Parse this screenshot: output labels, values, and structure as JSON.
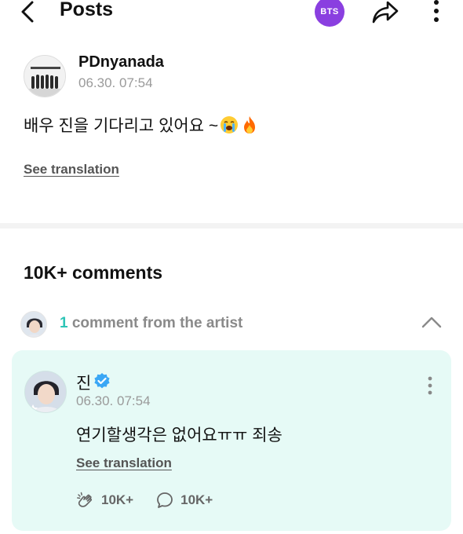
{
  "header": {
    "title": "Posts",
    "community_badge": "BTS"
  },
  "post": {
    "author": "PDnyanada",
    "timestamp": "06.30. 07:54",
    "body": "배우 진을 기다리고 있어요 ~",
    "emojis": [
      "loudly-crying-face",
      "fire"
    ],
    "see_translation": "See translation"
  },
  "comments": {
    "count_label": "10K+ comments",
    "artist_row": {
      "count": "1",
      "label": "comment from the artist"
    },
    "artist_comment": {
      "author": "진",
      "timestamp": "06.30. 07:54",
      "body": "연기할생각은 없어요ㅠㅠ 죄송",
      "see_translation": "See translation",
      "likes": "10K+",
      "replies": "10K+"
    }
  },
  "colors": {
    "brand_purple": "#8a3fe0",
    "artist_accent": "#2ec4b6",
    "artist_card_bg": "#e6faf6",
    "verified_blue": "#3aa7f5"
  }
}
